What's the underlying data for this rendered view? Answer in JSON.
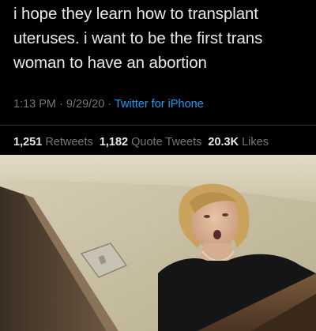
{
  "tweet": {
    "text": "i hope they learn how to transplant uteruses. i want to be the first trans woman to have an abortion",
    "time": "1:13 PM",
    "date": "9/29/20",
    "separator": "·",
    "client": "Twitter for iPhone"
  },
  "stats": {
    "retweets_count": "1,251",
    "retweets_label": "Retweets",
    "quotes_count": "1,182",
    "quotes_label": "Quote Tweets",
    "likes_count": "20.3K",
    "likes_label": "Likes"
  },
  "colors": {
    "background": "#000000",
    "text": "#e7e9ea",
    "muted": "#71767b",
    "link": "#1d9bf0"
  }
}
